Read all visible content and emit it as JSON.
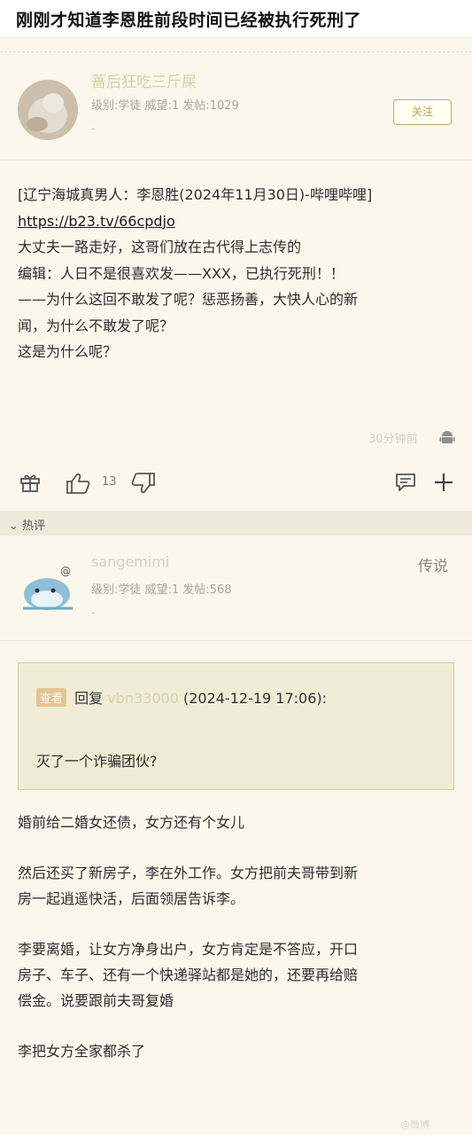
{
  "page": {
    "title": "刚刚才知道李恩胜前段时间已经被执行死刑了"
  },
  "post": {
    "author": {
      "name": "蔷后狂吃三斤屎",
      "meta": "级别:学徒 威望:1 发帖:1029",
      "extra": "-"
    },
    "follow_label": "关注",
    "lines": [
      "[辽宁海城真男人：李恩胜(2024年11月30日)-哔哩哔哩]",
      "https://b23.tv/66cpdjo",
      "大丈夫一路走好，这哥们放在古代得上志传的",
      "编辑：人日不是很喜欢发——XXX，已执行死刑！！",
      "——为什么这回不敢发了呢？惩恶扬善，大快人心的新",
      "闻，为什么不敢发了呢？",
      "这是为什么呢？"
    ],
    "timestamp": "30分钟前",
    "like_count": "13",
    "icons": [
      "gift-icon",
      "thumbs-up-icon",
      "thumbs-down-icon",
      "comment-icon",
      "plus-icon",
      "android-icon"
    ]
  },
  "hot_section": {
    "label": "热评"
  },
  "reply": {
    "author": {
      "name": "sangemimi",
      "meta": "级别:学徒 威望:1 发帖:568",
      "extra": "-"
    },
    "floor_label": "传说",
    "quote": {
      "tag": "查看",
      "prefix": "回复",
      "user": "vbn33000",
      "time": "(2024-12-19 17:06):",
      "text": "灭了一个诈骗团伙?"
    },
    "paragraphs": [
      [
        "婚前给二婚女还债，女方还有个女儿"
      ],
      [
        "然后还买了新房子，李在外工作。女方把前夫哥带到新",
        "房一起逍遥快活，后面领居告诉李。"
      ],
      [
        "李要离婚，让女方净身出户，女方肯定是不答应，开口",
        "房子、车子、还有一个快递驿站都是她的，还要再给赔",
        "偿金。说要跟前夫哥复婚"
      ],
      [
        "李把女方全家都杀了"
      ]
    ]
  },
  "watermark": "@微博"
}
